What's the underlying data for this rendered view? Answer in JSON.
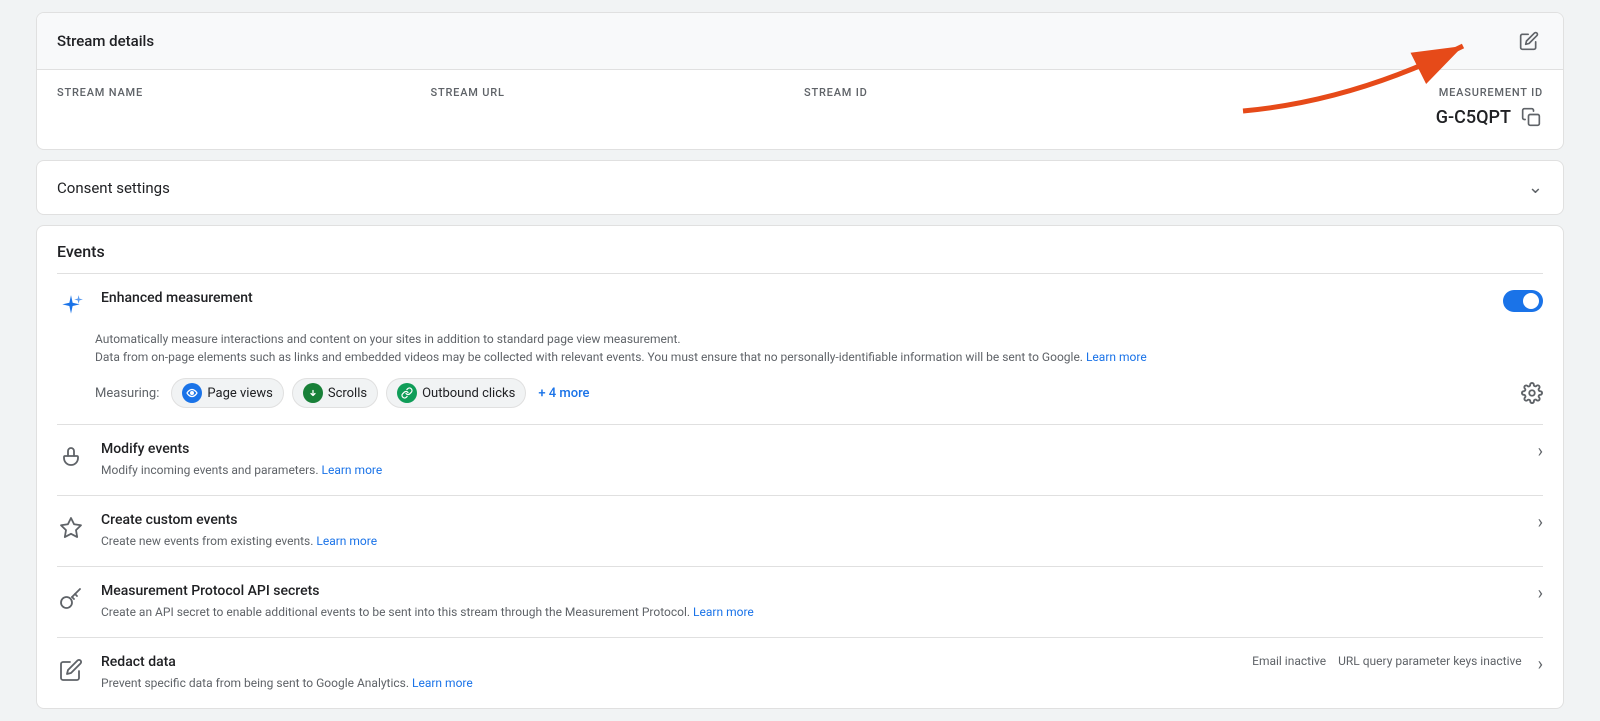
{
  "streamDetails": {
    "title": "Stream details",
    "editIcon": "pencil",
    "columns": [
      {
        "label": "STREAM NAME",
        "value": ""
      },
      {
        "label": "STREAM URL",
        "value": ""
      },
      {
        "label": "STREAM ID",
        "value": ""
      },
      {
        "label": "MEASUREMENT ID",
        "value": "G-C5QPT"
      }
    ],
    "copyIcon": "copy"
  },
  "consentSettings": {
    "title": "Consent settings",
    "chevronIcon": "chevron-down"
  },
  "events": {
    "sectionTitle": "Events",
    "enhancedMeasurement": {
      "icon": "sparkle",
      "title": "Enhanced measurement",
      "description1": "Automatically measure interactions and content on your sites in addition to standard page view measurement.",
      "description2": "Data from on-page elements such as links and embedded videos may be collected with relevant events. You must ensure that no personally-identifiable information will be sent to Google.",
      "learnMoreText": "Learn more",
      "learnMoreUrl": "#",
      "measuringLabel": "Measuring:",
      "chips": [
        {
          "label": "Page views",
          "color": "blue"
        },
        {
          "label": "Scrolls",
          "color": "green"
        },
        {
          "label": "Outbound clicks",
          "color": "teal"
        }
      ],
      "moreText": "+ 4 more",
      "toggleEnabled": true,
      "gearIcon": "gear"
    },
    "items": [
      {
        "id": "modify-events",
        "icon": "finger-tap",
        "title": "Modify events",
        "description": "Modify incoming events and parameters.",
        "learnMoreText": "Learn more",
        "hasArrow": true,
        "extraContent": null
      },
      {
        "id": "create-custom-events",
        "icon": "sparkle-small",
        "title": "Create custom events",
        "description": "Create new events from existing events.",
        "learnMoreText": "Learn more",
        "hasArrow": true,
        "extraContent": null
      },
      {
        "id": "measurement-protocol",
        "icon": "key",
        "title": "Measurement Protocol API secrets",
        "description": "Create an API secret to enable additional events to be sent into this stream through the Measurement Protocol.",
        "learnMoreText": "Learn more",
        "hasArrow": true,
        "extraContent": null
      },
      {
        "id": "redact-data",
        "icon": "pencil-slash",
        "title": "Redact data",
        "description": "Prevent specific data from being sent to Google Analytics.",
        "learnMoreText": "Learn more",
        "hasArrow": true,
        "extraContent": {
          "items": [
            "Email inactive",
            "URL query parameter keys inactive"
          ]
        }
      }
    ]
  },
  "arrow": {
    "color": "#e64a19"
  }
}
